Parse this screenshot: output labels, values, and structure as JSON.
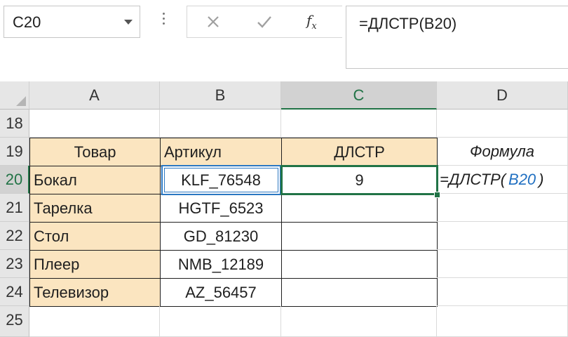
{
  "name_box": {
    "value": "C20"
  },
  "formula_bar": {
    "cancel_icon": "x-icon",
    "enter_icon": "check-icon",
    "fx_label": "fx",
    "formula": "=ДЛСТР(B20)"
  },
  "columns": [
    "A",
    "B",
    "C",
    "D"
  ],
  "rows": [
    "18",
    "19",
    "20",
    "21",
    "22",
    "23",
    "24",
    "25"
  ],
  "table": {
    "headers": [
      "Товар",
      "Артикул",
      "ДЛСТР"
    ],
    "items": [
      {
        "name": "Бокал",
        "sku": "KLF_76548",
        "len": "9"
      },
      {
        "name": "Тарелка",
        "sku": "HGTF_6523",
        "len": ""
      },
      {
        "name": "Стол",
        "sku": "GD_81230",
        "len": ""
      },
      {
        "name": "Плеер",
        "sku": "NMB_12189",
        "len": ""
      },
      {
        "name": "Телевизор",
        "sku": "AZ_56457",
        "len": ""
      }
    ]
  },
  "annotation": {
    "label": "Формула",
    "formula_prefix": "=ДЛСТР(",
    "formula_ref": "B20",
    "formula_suffix": ")"
  },
  "colors": {
    "accent": "#217346",
    "header_fill": "#fbe5c0",
    "ref_blue": "#2b78c2"
  }
}
